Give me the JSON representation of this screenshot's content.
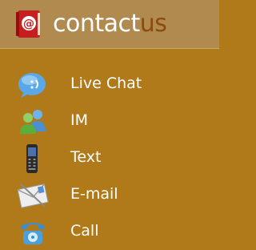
{
  "header": {
    "title_part1": "contact",
    "title_part2": "us",
    "icon": "address-book-icon",
    "icon_glyph": "@"
  },
  "menu": {
    "items": [
      {
        "label": "Live Chat",
        "icon": "chat-bubble-icon"
      },
      {
        "label": "IM",
        "icon": "instant-messenger-icon"
      },
      {
        "label": "Text",
        "icon": "mobile-phone-icon"
      },
      {
        "label": "E-mail",
        "icon": "envelope-icon"
      },
      {
        "label": "Call",
        "icon": "telephone-icon"
      }
    ]
  },
  "colors": {
    "background": "#b07a1a",
    "header_background": "#b08a4f",
    "title_accent": "#8a4a10",
    "text": "#ffffff"
  }
}
